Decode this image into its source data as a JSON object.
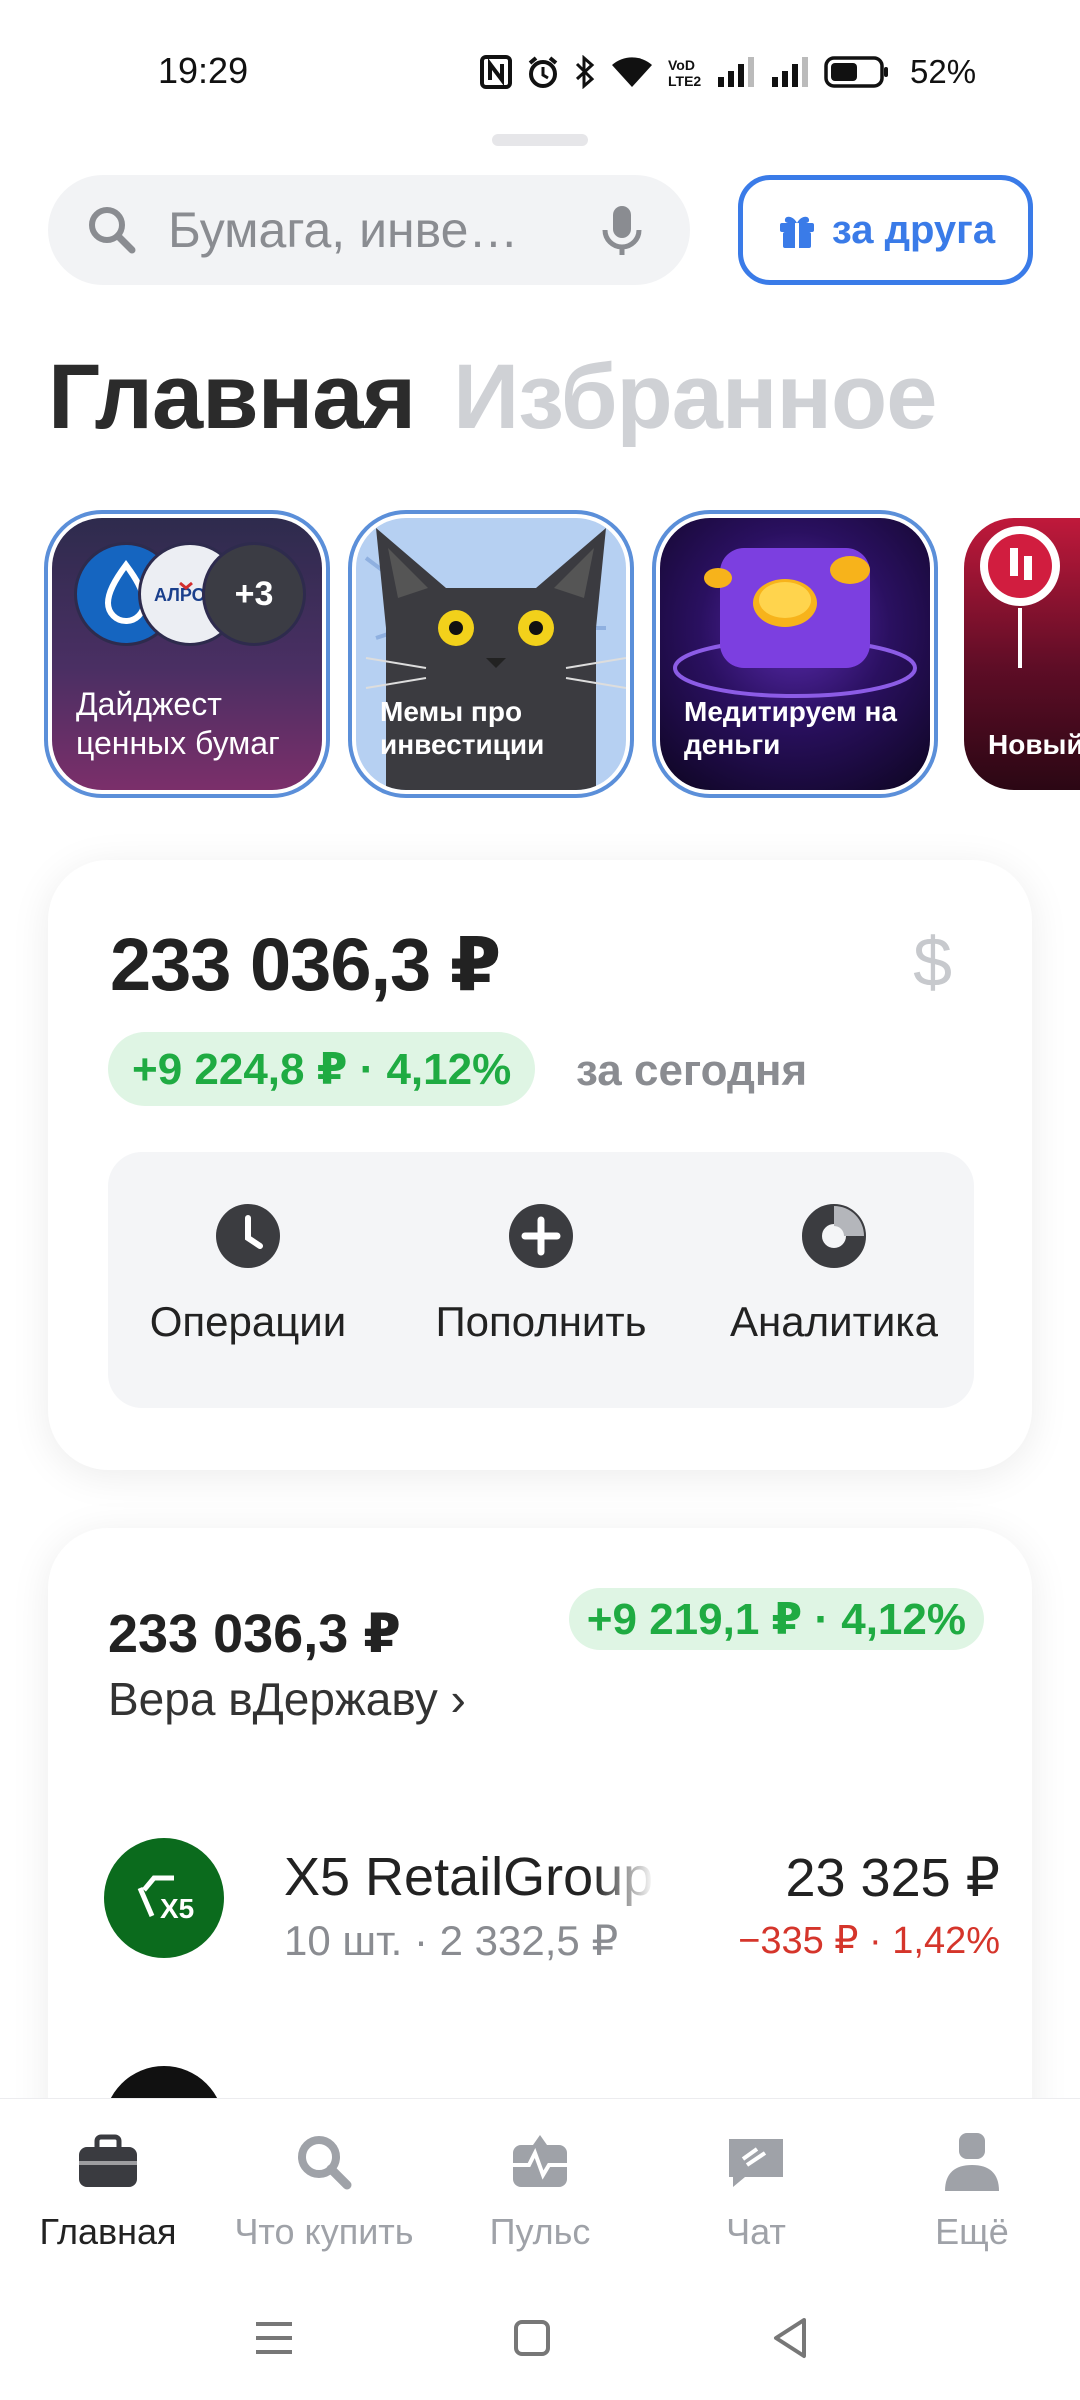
{
  "status_bar": {
    "time": "19:29",
    "battery": "52%"
  },
  "search": {
    "placeholder": "Бумага, инве…"
  },
  "friend_button": {
    "label": "за друга"
  },
  "tabs": [
    {
      "label": "Главная",
      "active": true
    },
    {
      "label": "Избранное",
      "active": false
    }
  ],
  "stories": [
    {
      "label": "Дайджест ценных бумаг",
      "badge": "+3"
    },
    {
      "label": "Мемы про инвестиции"
    },
    {
      "label": "Медитируем на деньги"
    },
    {
      "label": "Новый для убы"
    }
  ],
  "portfolio": {
    "total": "233 036,3 ₽",
    "currency_toggle": "$",
    "day_change": "+9 224,8 ₽ · 4,12%",
    "day_change_label": "за сегодня",
    "actions": [
      {
        "label": "Операции",
        "icon": "clock-icon"
      },
      {
        "label": "Пополнить",
        "icon": "plus-icon"
      },
      {
        "label": "Аналитика",
        "icon": "donut-chart-icon"
      }
    ]
  },
  "account": {
    "total": "233 036,3 ₽",
    "name": "Вера вДержаву ›",
    "change": "+9 219,1 ₽ · 4,12%",
    "positions": [
      {
        "name": "X5 RetailGroup",
        "logo_text": "X5",
        "qty": "10 шт. · 2 332,5 ₽",
        "value": "23 325 ₽",
        "change": "−335 ₽ · 1,42%",
        "logo_color": "#0b6b1d"
      }
    ]
  },
  "bottom_nav": [
    {
      "label": "Главная",
      "icon": "briefcase-icon",
      "active": true
    },
    {
      "label": "Что купить",
      "icon": "search-icon",
      "active": false
    },
    {
      "label": "Пульс",
      "icon": "pulse-icon",
      "active": false
    },
    {
      "label": "Чат",
      "icon": "chat-icon",
      "active": false
    },
    {
      "label": "Ещё",
      "icon": "profile-icon",
      "active": false
    }
  ],
  "colors": {
    "accent": "#3a7be8",
    "positive": "#1fab42",
    "negative": "#d5352b"
  }
}
